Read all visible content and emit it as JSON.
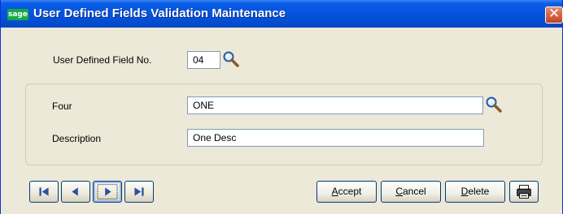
{
  "window": {
    "title": "User Defined Fields Validation Maintenance",
    "logo_text": "sage",
    "close_icon": "close-icon"
  },
  "header": {
    "field_no_label": "User Defined Field No.",
    "field_no_value": "04",
    "lookup_icon": "magnifier-icon"
  },
  "group": {
    "four_label": "Four",
    "four_value": "ONE",
    "description_label": "Description",
    "description_value": "One Desc"
  },
  "nav": {
    "first_icon": "first-record-icon",
    "previous_icon": "previous-record-icon",
    "next_icon": "next-record-icon",
    "last_icon": "last-record-icon"
  },
  "actions": {
    "accept_mnemonic": "A",
    "accept_rest": "ccept",
    "cancel_mnemonic": "C",
    "cancel_rest": "ancel",
    "delete_mnemonic": "D",
    "delete_rest": "elete",
    "print_icon": "printer-icon"
  },
  "colors": {
    "title_bar": "#0a5fe6",
    "window_bg": "#ece9d8",
    "logo": "#19a84a",
    "close_button": "#c4401f"
  }
}
